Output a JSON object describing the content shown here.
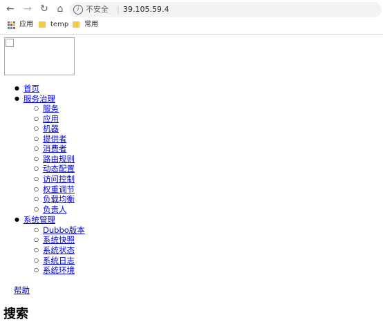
{
  "browser": {
    "security_label": "不安全",
    "separator": "|",
    "url": "39.105.59.4",
    "bookmarks": [
      {
        "label": "应用",
        "icon": "apps-grid-icon"
      },
      {
        "label": "temp",
        "icon": "folder-icon"
      },
      {
        "label": "常用",
        "icon": "folder-icon"
      }
    ]
  },
  "nav": {
    "home": "首页",
    "service_governance": {
      "label": "服务治理",
      "items": [
        "服务",
        "应用",
        "机器",
        "提供者",
        "消费者",
        "路由规则",
        "动态配置",
        "访问控制",
        "权重调节",
        "负载均衡",
        "负责人"
      ]
    },
    "system_management": {
      "label": "系统管理",
      "items": [
        "Dubbo版本",
        "系统快照",
        "系统状态",
        "系统日志",
        "系统环境"
      ]
    },
    "help": "帮助"
  },
  "main": {
    "heading": "搜索"
  },
  "colors": {
    "link": "#0000ee",
    "omnibox_bg": "#f1f3f4",
    "folder": "#f6c94a"
  }
}
